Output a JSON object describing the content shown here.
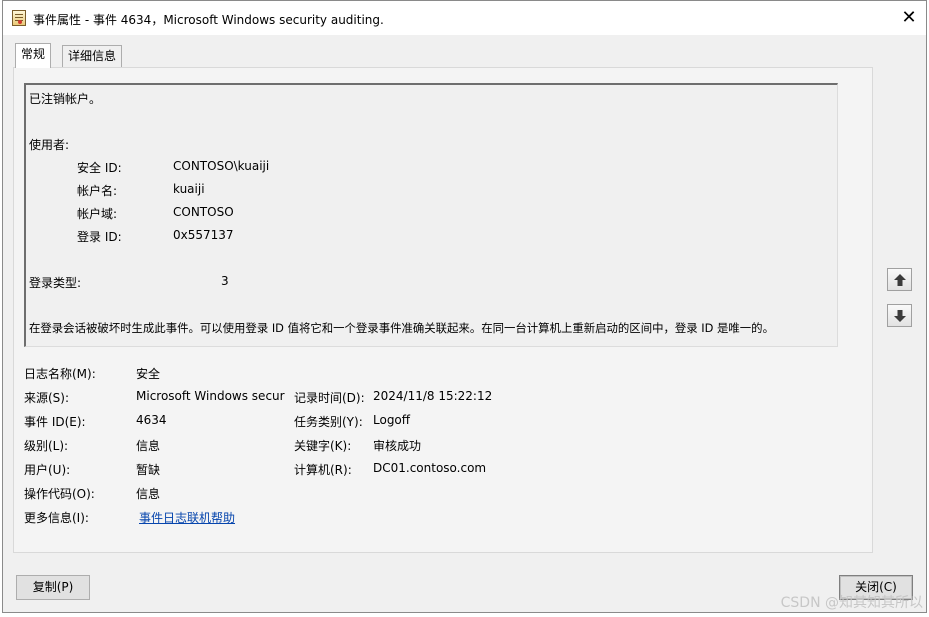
{
  "window": {
    "title": "事件属性 - 事件 4634，Microsoft Windows security auditing.",
    "close_glyph": "✕",
    "icon": "event-properties-icon"
  },
  "tabs": [
    {
      "label": "常规",
      "active": true
    },
    {
      "label": "详细信息",
      "active": false
    }
  ],
  "description": {
    "heading": "已注销帐户。",
    "subject_label": "使用者:",
    "subject_fields": [
      {
        "label": "安全 ID:",
        "value": "CONTOSO\\kuaiji"
      },
      {
        "label": "帐户名:",
        "value": "kuaiji"
      },
      {
        "label": "帐户域:",
        "value": "CONTOSO"
      },
      {
        "label": "登录 ID:",
        "value": "0x557137"
      }
    ],
    "logon_type_label": "登录类型:",
    "logon_type_value": "3",
    "note": "在登录会话被破坏时生成此事件。可以使用登录 ID 值将它和一个登录事件准确关联起来。在同一台计算机上重新启动的区间中，登录 ID 是唯一的。"
  },
  "fields": {
    "log_name": {
      "label": "日志名称(M):",
      "value": "安全"
    },
    "source": {
      "label": "来源(S):",
      "value": "Microsoft Windows secur"
    },
    "logged": {
      "label": "记录时间(D):",
      "value": "2024/11/8 15:22:12"
    },
    "event_id": {
      "label": "事件 ID(E):",
      "value": "4634"
    },
    "task_category": {
      "label": "任务类别(Y):",
      "value": "Logoff"
    },
    "level": {
      "label": "级别(L):",
      "value": "信息"
    },
    "keywords": {
      "label": "关键字(K):",
      "value": "审核成功"
    },
    "user": {
      "label": "用户(U):",
      "value": "暂缺"
    },
    "computer": {
      "label": "计算机(R):",
      "value": "DC01.contoso.com"
    },
    "opcode": {
      "label": "操作代码(O):",
      "value": "信息"
    },
    "more_info": {
      "label": "更多信息(I):",
      "value": "事件日志联机帮助"
    }
  },
  "nav": {
    "up_icon": "arrow-up-icon",
    "down_icon": "arrow-down-icon"
  },
  "buttons": {
    "copy": "复制(P)",
    "close": "关闭(C)"
  },
  "watermark": "CSDN @知其知其所以"
}
